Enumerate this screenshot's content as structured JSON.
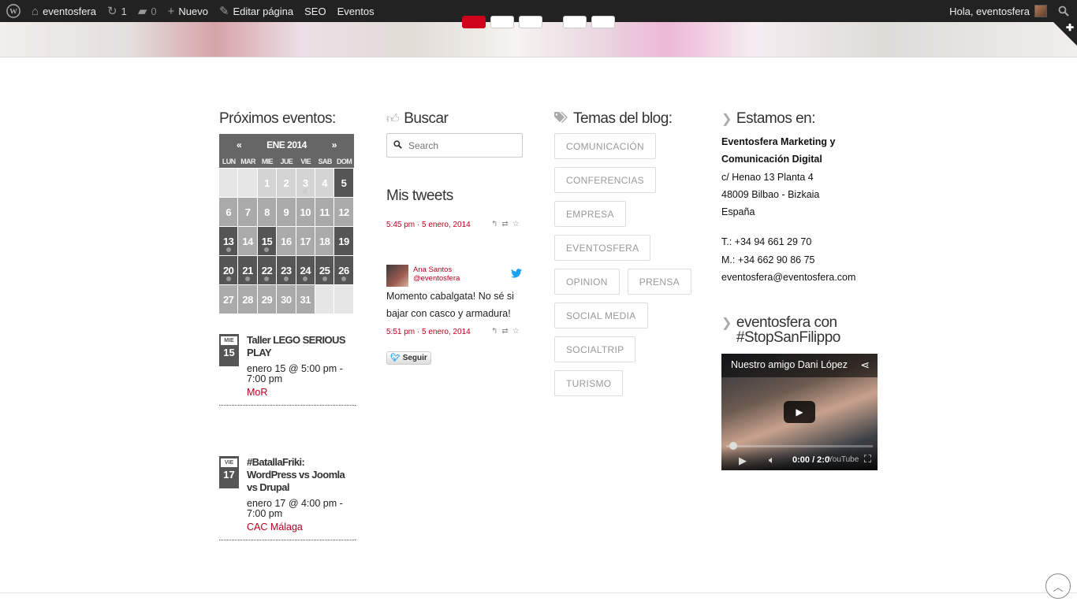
{
  "adminbar": {
    "site": "eventosfera",
    "updates": "1",
    "comments": "0",
    "new_label": "Nuevo",
    "edit_label": "Editar página",
    "seo_label": "SEO",
    "events_label": "Eventos",
    "greeting": "Hola, eventosfera"
  },
  "events_widget": {
    "title": "Próximos eventos:",
    "calendar": {
      "prev": "«",
      "month": "ENE 2014",
      "next": "»",
      "weekdays": [
        "LUN",
        "MAR",
        "MIE",
        "JUE",
        "VIE",
        "SAB",
        "DOM"
      ],
      "cells": [
        "",
        "",
        "1",
        "2",
        "3",
        "4",
        "5",
        "6",
        "7",
        "8",
        "9",
        "10",
        "11",
        "12",
        "13",
        "14",
        "15",
        "16",
        "17",
        "18",
        "19",
        "20",
        "21",
        "22",
        "23",
        "24",
        "25",
        "26",
        "27",
        "28",
        "29",
        "30",
        "31",
        "",
        ""
      ]
    },
    "events": [
      {
        "weekday": "MIE",
        "day": "15",
        "title": "Taller LEGO SERIOUS PLAY",
        "time": "enero 15 @ 5:00 pm - 7:00 pm",
        "venue": "MoR"
      },
      {
        "weekday": "VIE",
        "day": "17",
        "title": "#BatallaFriki: WordPress vs Joomla vs Drupal",
        "time": "enero 17 @ 4:00 pm - 7:00 pm",
        "venue": "CAC Málaga"
      }
    ]
  },
  "search_widget": {
    "title": "Buscar",
    "placeholder": "Search"
  },
  "tweets_widget": {
    "title": "Mis tweets",
    "tweets": [
      {
        "meta": "5:45 pm · 5 enero, 2014"
      },
      {
        "author": "Ana Santos",
        "handle": "@eventosfera",
        "text": "Momento cabalgata! No sé si bajar con casco y armadura!",
        "meta": "5:51 pm · 5 enero, 2014"
      }
    ],
    "follow_label": "Seguir"
  },
  "tags_widget": {
    "title": "Temas del blog:",
    "tags": [
      "COMUNICACIÓN",
      "CONFERENCIAS",
      "EMPRESA",
      "EVENTOSFERA",
      "OPINION",
      "PRENSA",
      "SOCIAL MEDIA",
      "SOCIALTRIP",
      "TURISMO"
    ]
  },
  "contact_widget": {
    "title": "Estamos en:",
    "company_line1": "Eventosfera Marketing y",
    "company_line2": "Comunicación Digital",
    "address1": "c/ Henao 13 Planta 4",
    "address2": "48009 Bilbao - Bizkaia",
    "country": "España",
    "phone": "T.: +34 94 661 29 70",
    "mobile": "M.: +34 662 90 86 75",
    "email": "eventosfera@eventosfera.com"
  },
  "video_widget": {
    "title": "eventosfera con #StopSanFilippo",
    "video_title": "Nuestro amigo Dani López",
    "time": "0:00 / 2:0",
    "yt": "YouTube"
  }
}
